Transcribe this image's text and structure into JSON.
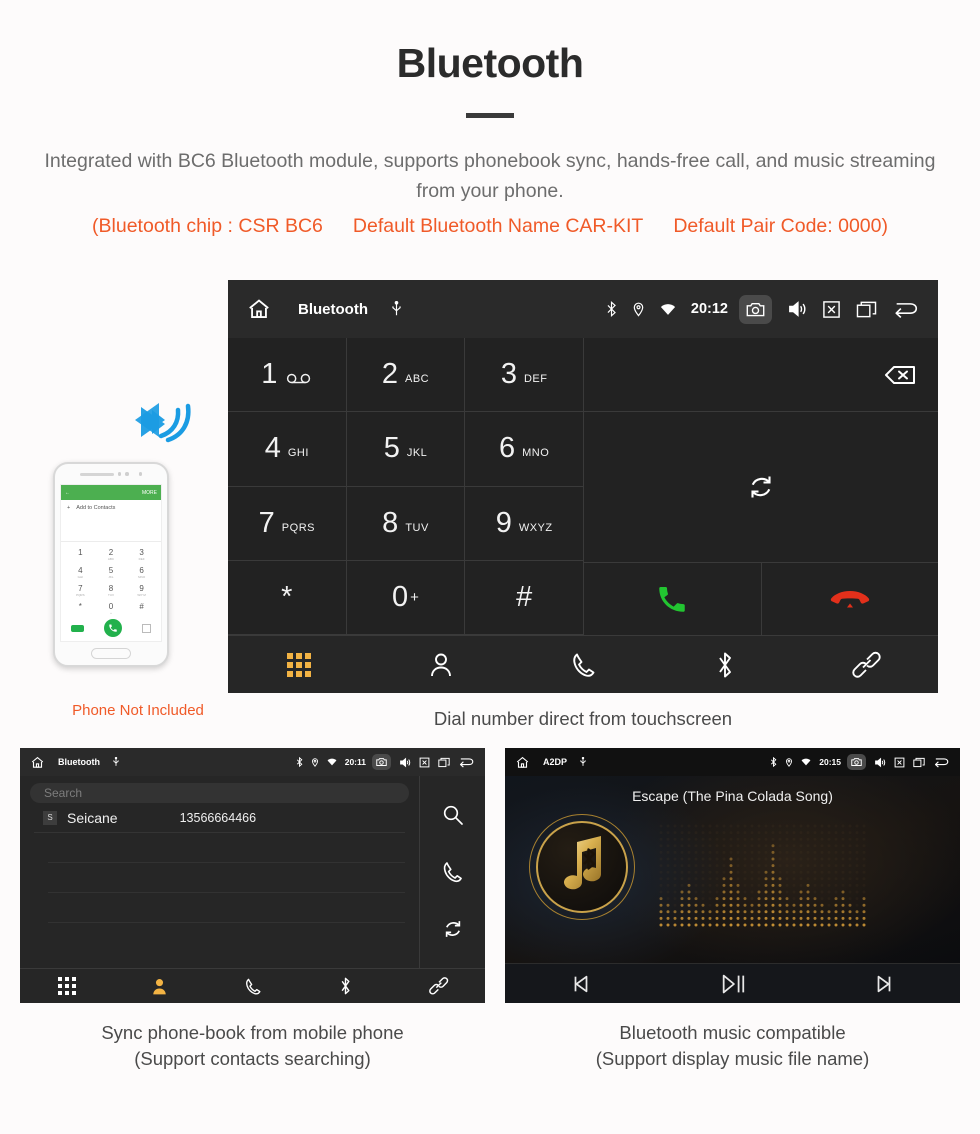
{
  "header": {
    "title": "Bluetooth",
    "description": "Integrated with BC6 Bluetooth module, supports phonebook sync, hands-free call, and music streaming from your phone.",
    "spec_chip": "(Bluetooth chip : CSR BC6",
    "spec_name": "Default Bluetooth Name CAR-KIT",
    "spec_code": "Default Pair Code: 0000)",
    "accent_color": "#f05a28"
  },
  "dialer": {
    "statusbar": {
      "home_icon": "home-icon",
      "title": "Bluetooth",
      "usb_icon": "usb-icon",
      "bluetooth_icon": "bluetooth-icon",
      "location_icon": "location-icon",
      "wifi_icon": "wifi-icon",
      "time": "20:12",
      "camera_icon": "camera-icon",
      "volume_icon": "volume-icon",
      "close_icon": "close-box-icon",
      "recents_icon": "recent-apps-icon",
      "back_icon": "back-arrow-icon"
    },
    "keys": [
      {
        "num": "1",
        "letters": "",
        "icon": "voicemail-icon"
      },
      {
        "num": "2",
        "letters": "ABC",
        "icon": ""
      },
      {
        "num": "3",
        "letters": "DEF",
        "icon": ""
      },
      {
        "num": "4",
        "letters": "GHI",
        "icon": ""
      },
      {
        "num": "5",
        "letters": "JKL",
        "icon": ""
      },
      {
        "num": "6",
        "letters": "MNO",
        "icon": ""
      },
      {
        "num": "7",
        "letters": "PQRS",
        "icon": ""
      },
      {
        "num": "8",
        "letters": "TUV",
        "icon": ""
      },
      {
        "num": "9",
        "letters": "WXYZ",
        "icon": ""
      },
      {
        "num": "*",
        "letters": "",
        "icon": ""
      },
      {
        "num": "0",
        "letters": "",
        "icon": "",
        "plus": "+"
      },
      {
        "num": "#",
        "letters": "",
        "icon": ""
      }
    ],
    "backspace_icon": "backspace-icon",
    "sync_icon": "sync-icon",
    "call_icon": "call-answer-icon",
    "hangup_icon": "call-end-icon",
    "call_color": "#22c531",
    "hangup_color": "#e3301b",
    "nav": [
      {
        "name": "keypad",
        "icon": "keypad-grid-icon",
        "active": true
      },
      {
        "name": "contacts",
        "icon": "contact-person-icon",
        "active": false
      },
      {
        "name": "call-log",
        "icon": "phone-handset-icon",
        "active": false
      },
      {
        "name": "bluetooth",
        "icon": "bluetooth-icon",
        "active": false
      },
      {
        "name": "link",
        "icon": "link-chain-icon",
        "active": false
      }
    ],
    "active_color": "#f2b344"
  },
  "phone_mock": {
    "app_back_icon": "back-arrow-icon",
    "app_more_label": "MORE",
    "add_contacts_label": "Add to Contacts",
    "keys": [
      {
        "num": "1",
        "letters": ""
      },
      {
        "num": "2",
        "letters": "ABC"
      },
      {
        "num": "3",
        "letters": "DEF"
      },
      {
        "num": "4",
        "letters": "GHI"
      },
      {
        "num": "5",
        "letters": "JKL"
      },
      {
        "num": "6",
        "letters": "MNO"
      },
      {
        "num": "7",
        "letters": "PQRS"
      },
      {
        "num": "8",
        "letters": "TUV"
      },
      {
        "num": "9",
        "letters": "WXYZ"
      },
      {
        "num": "*",
        "letters": ""
      },
      {
        "num": "0",
        "letters": "+"
      },
      {
        "num": "#",
        "letters": ""
      }
    ],
    "not_included_label": "Phone Not Included"
  },
  "captions": {
    "dialer": "Dial number direct from touchscreen",
    "phonebook_line1": "Sync phone-book from mobile phone",
    "phonebook_line2": "(Support contacts searching)",
    "music_line1": "Bluetooth music compatible",
    "music_line2": "(Support display music file name)"
  },
  "phonebook": {
    "statusbar": {
      "title": "Bluetooth",
      "time": "20:11"
    },
    "search_placeholder": "Search",
    "contact": {
      "badge": "S",
      "name": "Seicane",
      "number": "13566664466"
    },
    "side_icons": [
      {
        "name": "search",
        "icon": "search-icon"
      },
      {
        "name": "dial",
        "icon": "phone-handset-icon"
      },
      {
        "name": "sync",
        "icon": "sync-icon"
      }
    ],
    "nav": [
      {
        "name": "keypad",
        "icon": "keypad-grid-icon",
        "active": false
      },
      {
        "name": "contacts",
        "icon": "contact-person-icon",
        "active": true
      },
      {
        "name": "call-log",
        "icon": "phone-handset-icon",
        "active": false
      },
      {
        "name": "bluetooth",
        "icon": "bluetooth-icon",
        "active": false
      },
      {
        "name": "link",
        "icon": "link-chain-icon",
        "active": false
      }
    ]
  },
  "music": {
    "statusbar": {
      "title": "A2DP",
      "time": "20:15"
    },
    "song_title": "Escape (The Pina Colada Song)",
    "album_icon": "music-note-bluetooth-icon",
    "visualizer": "dot-matrix-equalizer",
    "controls": [
      {
        "name": "previous",
        "icon": "skip-previous-icon"
      },
      {
        "name": "play-pause",
        "icon": "play-pause-icon"
      },
      {
        "name": "next",
        "icon": "skip-next-icon"
      }
    ],
    "accent_color": "#c9a24a"
  }
}
